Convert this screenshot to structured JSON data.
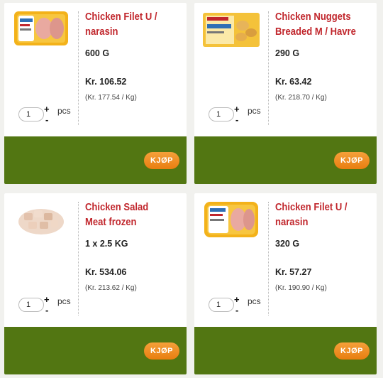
{
  "colors": {
    "product_name": "#c1272d",
    "footer_green": "#527612",
    "buy_orange": "#ee8a1f"
  },
  "products": [
    {
      "name": "Chicken Filet U / narasin",
      "weight": "600 G",
      "price": "Kr. 106.52",
      "unit_price": "(Kr. 177.54 / Kg)",
      "quantity": "1",
      "plus_label": "+",
      "minus_label": "-",
      "unit_label": "pcs",
      "buy_label": "KJØP",
      "image_icon": "chicken-filet-tray-image"
    },
    {
      "name": "Chicken Nuggets Breaded M / Havre",
      "weight": "290 G",
      "price": "Kr. 63.42",
      "unit_price": "(Kr. 218.70 / Kg)",
      "quantity": "1",
      "plus_label": "+",
      "minus_label": "-",
      "unit_label": "pcs",
      "buy_label": "KJØP",
      "image_icon": "chicken-nuggets-bag-image"
    },
    {
      "name": "Chicken Salad Meat frozen",
      "weight": "1 x 2.5 KG",
      "price": "Kr. 534.06",
      "unit_price": "(Kr. 213.62 / Kg)",
      "quantity": "1",
      "plus_label": "+",
      "minus_label": "-",
      "unit_label": "pcs",
      "buy_label": "KJØP",
      "image_icon": "diced-chicken-meat-image"
    },
    {
      "name": "Chicken Filet U / narasin",
      "weight": "320 G",
      "price": "Kr. 57.27",
      "unit_price": "(Kr. 190.90 / Kg)",
      "quantity": "1",
      "plus_label": "+",
      "minus_label": "-",
      "unit_label": "pcs",
      "buy_label": "KJØP",
      "image_icon": "chicken-filet-tray-image"
    }
  ]
}
